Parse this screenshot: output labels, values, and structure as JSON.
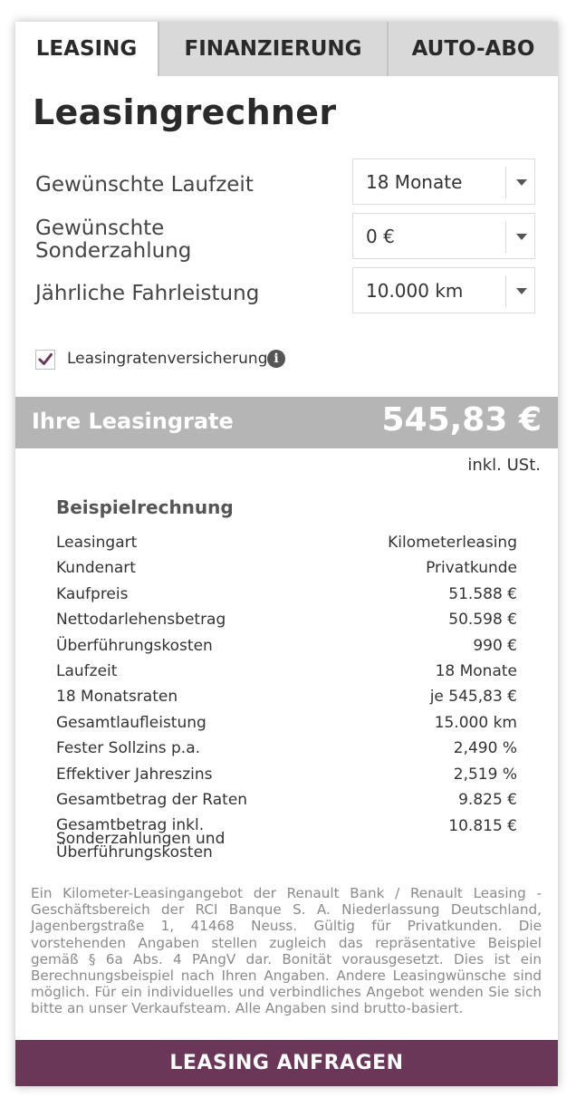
{
  "tabs": [
    {
      "label": "LEASING",
      "active": true
    },
    {
      "label": "FINANZIERUNG",
      "active": false
    },
    {
      "label": "AUTO-ABO",
      "active": false
    }
  ],
  "title": "Leasingrechner",
  "form": {
    "duration": {
      "label": "Gewünschte Laufzeit",
      "value": "18 Monate"
    },
    "down_payment": {
      "label_line1": "Gewünschte",
      "label_line2": "Sonderzahlung",
      "value": "0 €"
    },
    "mileage": {
      "label": "Jährliche Fahrleistung",
      "value": "10.000 km"
    }
  },
  "insurance": {
    "label": "Leasingratenversicherung",
    "checked": true,
    "info_icon": "info-icon"
  },
  "rate": {
    "label": "Ihre Leasingrate",
    "value": "545,83 €",
    "vat_note": "inkl. USt."
  },
  "example": {
    "title": "Beispielrechnung",
    "rows": [
      {
        "key": "Leasingart",
        "value": "Kilometerleasing"
      },
      {
        "key": "Kundenart",
        "value": "Privatkunde"
      },
      {
        "key": "Kaufpreis",
        "value": "51.588 €"
      },
      {
        "key": "Nettodarlehensbetrag",
        "value": "50.598 €"
      },
      {
        "key": "Überführungskosten",
        "value": "990 €"
      },
      {
        "key": "Laufzeit",
        "value": "18 Monate"
      },
      {
        "key": "18 Monatsraten",
        "value": "je 545,83 €"
      },
      {
        "key": "Gesamtlaufleistung",
        "value": "15.000 km"
      },
      {
        "key": "Fester Sollzins p.a.",
        "value": "2,490 %"
      },
      {
        "key": "Effektiver Jahreszins",
        "value": "2,519 %"
      },
      {
        "key": "Gesamtbetrag der Raten",
        "value": "9.825 €"
      },
      {
        "key": "Gesamtbetrag inkl. Sonderzahlungen und Überführungskosten",
        "value": "10.815 €"
      }
    ]
  },
  "disclaimer": "Ein Kilometer-Leasingangebot der Renault Bank / Renault Leasing - Geschäftsbereich der RCI Banque S. A. Niederlassung Deutschland, Jagenbergstraße 1, 41468 Neuss. Gültig für Privatkunden. Die vorstehenden Angaben stellen zugleich das repräsentative Beispiel gemäß § 6a Abs. 4 PAngV dar. Bonität vorausgesetzt. Dies ist ein Berechnungsbeispiel nach Ihren Angaben. Andere Leasingwünsche sind möglich. Für ein individuelles und verbindliches Angebot wenden Sie sich bitte an unser Verkaufsteam. Alle Angaben sind brutto-basiert.",
  "cta": {
    "label": "LEASING ANFRAGEN"
  },
  "colors": {
    "accent": "#6a3758",
    "rate_bar": "#b5b5b5",
    "inactive_tab": "#d9d9d9"
  }
}
